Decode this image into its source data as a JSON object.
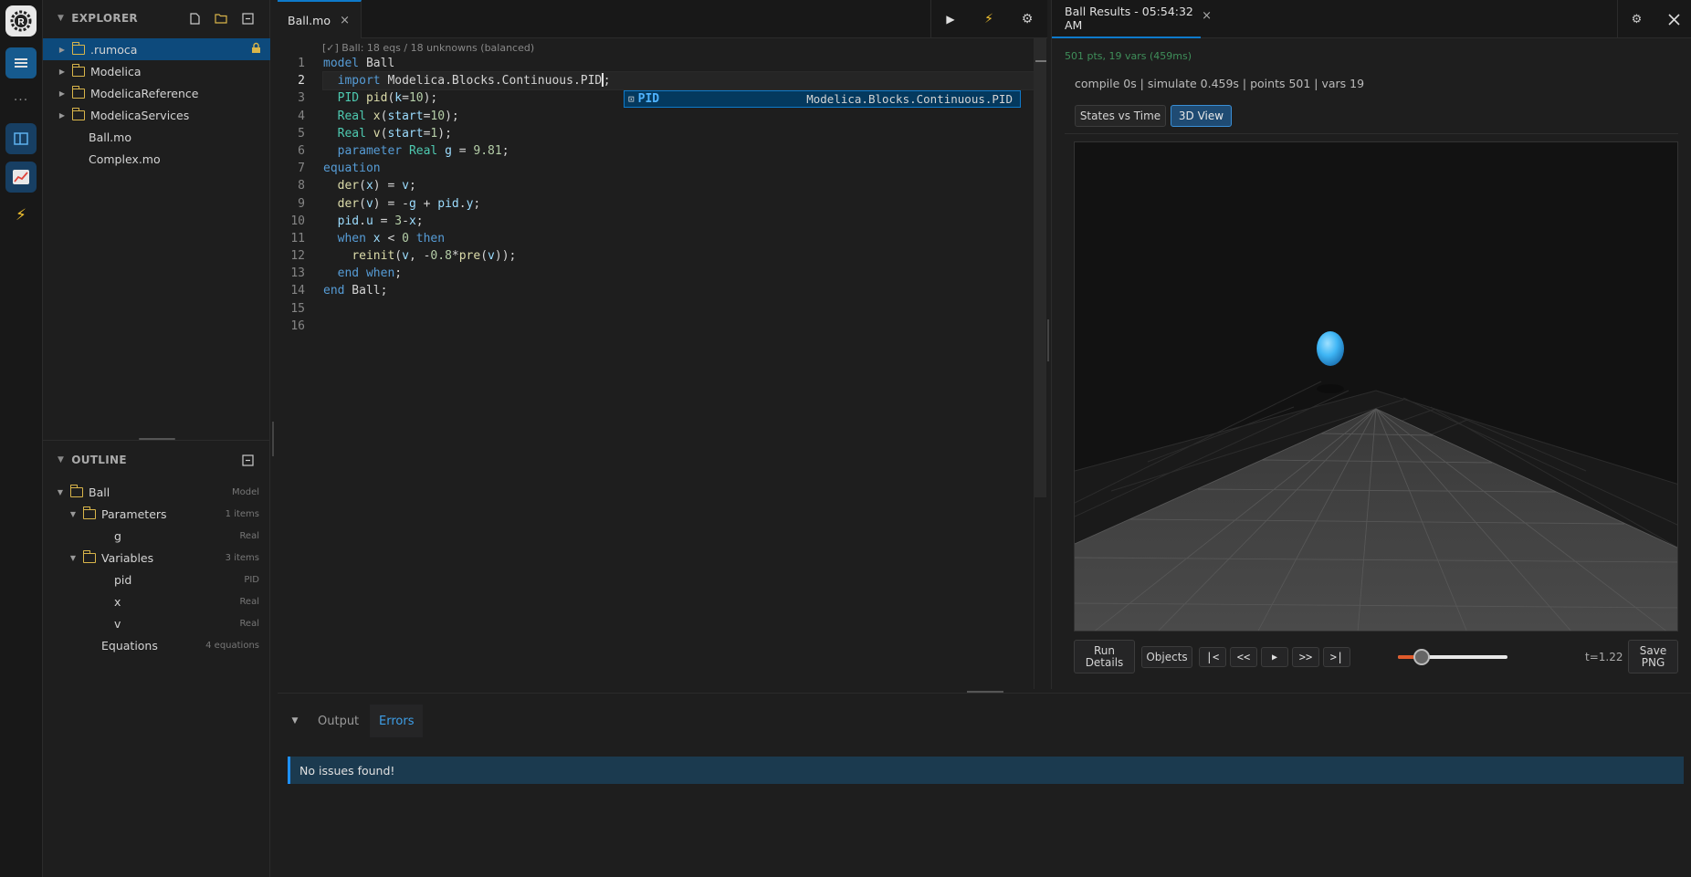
{
  "activity": {
    "items": [
      "menu-icon",
      "more-icon",
      "explorer-icon",
      "results-chart-icon",
      "lightning-icon"
    ]
  },
  "explorer": {
    "title": "EXPLORER",
    "items": [
      {
        "label": ".rumoca",
        "type": "folder",
        "locked": true
      },
      {
        "label": "Modelica",
        "type": "folder"
      },
      {
        "label": "ModelicaReference",
        "type": "folder"
      },
      {
        "label": "ModelicaServices",
        "type": "folder"
      },
      {
        "label": "Ball.mo",
        "type": "file"
      },
      {
        "label": "Complex.mo",
        "type": "file"
      }
    ]
  },
  "outline": {
    "title": "OUTLINE",
    "rows": [
      {
        "label": "Ball",
        "meta": "Model"
      },
      {
        "label": "Parameters",
        "meta": "1 items"
      },
      {
        "label": "g",
        "meta": "Real"
      },
      {
        "label": "Variables",
        "meta": "3 items"
      },
      {
        "label": "pid",
        "meta": "PID"
      },
      {
        "label": "x",
        "meta": "Real"
      },
      {
        "label": "v",
        "meta": "Real"
      },
      {
        "label": "Equations",
        "meta": "4 equations"
      }
    ]
  },
  "editor": {
    "tab_label": "Ball.mo",
    "tab_close": "×",
    "codelens": "[✓] Ball: 18 eqs / 18 unknowns (balanced)",
    "line_numbers": [
      "1",
      "2",
      "3",
      "4",
      "5",
      "6",
      "7",
      "8",
      "9",
      "10",
      "11",
      "12",
      "13",
      "14",
      "15",
      "16"
    ],
    "current_line": 2,
    "suggest": {
      "label": "PID",
      "detail": "Modelica.Blocks.Continuous.PID"
    }
  },
  "panel": {
    "tabs": [
      "Output",
      "Errors"
    ],
    "active_tab": "Errors",
    "message": "No issues found!"
  },
  "results": {
    "tab_label": "Ball Results - 05:54:32 AM",
    "tab_close": "×",
    "summary": "501 pts, 19 vars (459ms)",
    "stats": "compile 0s | simulate 0.459s | points 501 | vars 19",
    "views": [
      "States vs Time",
      "3D View"
    ],
    "active_view": "3D View",
    "controls": {
      "run_details": "Run Details",
      "objects": "Objects",
      "first": "|<",
      "back": "<<",
      "play": "▶",
      "fwd": ">>",
      "last": ">|",
      "time": "t=1.22",
      "save_png": "Save PNG",
      "slider_fraction": 0.22
    }
  },
  "colors": {
    "accent": "#0e7acb",
    "ball": "#3fb6f5",
    "keyword": "#569cd6",
    "type": "#4ec9b0",
    "number": "#b5cea8"
  }
}
